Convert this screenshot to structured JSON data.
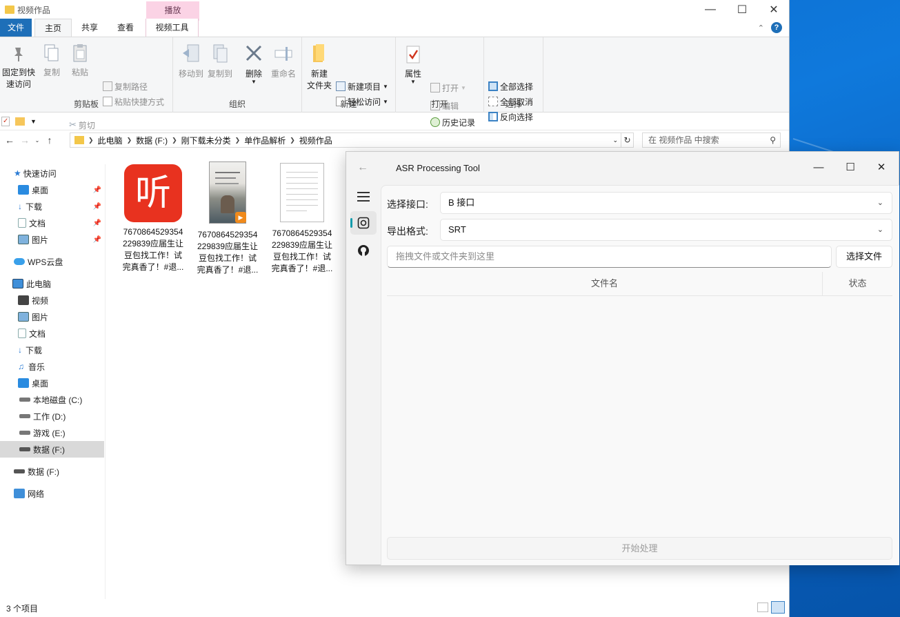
{
  "explorer": {
    "title": "视频作品",
    "context_tab_header": "播放",
    "tabs": [
      "文件",
      "主页",
      "共享",
      "查看",
      "视频工具"
    ],
    "ribbon": {
      "clipboard": {
        "group_label": "剪贴板",
        "pin_line1": "固定到快",
        "pin_line2": "速访问",
        "copy": "复制",
        "paste": "粘贴",
        "copy_path": "复制路径",
        "paste_shortcut": "粘贴快捷方式",
        "cut": "剪切"
      },
      "organize": {
        "group_label": "组织",
        "move_to": "移动到",
        "copy_to": "复制到",
        "delete": "删除",
        "rename": "重命名"
      },
      "new": {
        "group_label": "新建",
        "new_folder_line1": "新建",
        "new_folder_line2": "文件夹",
        "new_item": "新建项目",
        "easy_access": "轻松访问"
      },
      "open": {
        "group_label": "打开",
        "properties": "属性",
        "open": "打开",
        "edit": "编辑",
        "history": "历史记录"
      },
      "select": {
        "group_label": "选择",
        "select_all": "全部选择",
        "select_none": "全部取消",
        "invert": "反向选择"
      }
    },
    "address": {
      "crumbs": [
        "此电脑",
        "数据 (F:)",
        "刚下载未分类",
        "单作品解析",
        "视频作品"
      ],
      "search_placeholder": "在 视频作品 中搜索"
    },
    "nav": {
      "quick_access": "快速访问",
      "qa_items": [
        "桌面",
        "下载",
        "文档",
        "图片"
      ],
      "wps": "WPS云盘",
      "this_pc": "此电脑",
      "pc_items": [
        "视频",
        "图片",
        "文档",
        "下载",
        "音乐",
        "桌面",
        "本地磁盘 (C:)",
        "工作 (D:)",
        "游戏 (E:)",
        "数据 (F:)"
      ],
      "drive_f": "数据 (F:)",
      "network": "网络"
    },
    "files": [
      {
        "line1": "7670864529354",
        "line2": "229839应届生让",
        "line3": "豆包找工作！试",
        "line4": "完真香了！#退...",
        "icon": "ting-app-icon",
        "accent": "#e8321f",
        "glyph": "听"
      },
      {
        "line1": "7670864529354",
        "line2": "229839应届生让",
        "line3": "豆包找工作！试",
        "line4": "完真香了！#退...",
        "icon": "video-thumbnail"
      },
      {
        "line1": "7670864529354",
        "line2": "229839应届生让",
        "line3": "豆包找工作！试",
        "line4": "完真香了！#退...",
        "icon": "text-document-icon"
      }
    ],
    "status": "3 个项目"
  },
  "asr": {
    "title": "ASR Processing Tool",
    "interface_label": "选择接口:",
    "interface_value": "B 接口",
    "format_label": "导出格式:",
    "format_value": "SRT",
    "drop_placeholder": "拖拽文件或文件夹到这里",
    "select_file_button": "选择文件",
    "col_filename": "文件名",
    "col_status": "状态",
    "start_button": "开始处理",
    "accent": "#0f9bab"
  }
}
